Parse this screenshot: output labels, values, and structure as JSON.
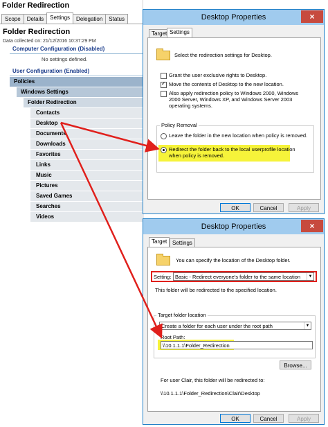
{
  "gpmc": {
    "title": "Folder Redirection",
    "tabs": [
      "Scope",
      "Details",
      "Settings",
      "Delegation",
      "Status"
    ],
    "active_tab": 2,
    "heading": "Folder Redirection",
    "data_collected": "Data collected on: 21/12/2016 10:37:29 PM",
    "computer_config": "Computer Configuration (Disabled)",
    "no_settings": "No settings defined.",
    "user_config": "User Configuration (Enabled)",
    "tree": {
      "policies": "Policies",
      "windows_settings": "Windows Settings",
      "folder_redirection": "Folder Redirection",
      "items": [
        "Contacts",
        "Desktop",
        "Documents",
        "Downloads",
        "Favorites",
        "Links",
        "Music",
        "Pictures",
        "Saved Games",
        "Searches",
        "Videos"
      ]
    }
  },
  "dialog_settings": {
    "title": "Desktop Properties",
    "close": "×",
    "tabs": [
      "Target",
      "Settings"
    ],
    "intro": "Select the redirection settings for Desktop.",
    "opt_exclusive": "Grant the user exclusive rights to Desktop.",
    "opt_move": "Move the contents of Desktop to the new location.",
    "opt_legacy": "Also apply redirection policy to Windows 2000, Windows 2000 Server, Windows XP, and Windows Server 2003 operating systems.",
    "policy_removal_label": "Policy Removal",
    "leave_option": "Leave the folder in the new location when policy is removed.",
    "redirect_back_option": "Redirect the folder back to the local userprofile location when policy is removed.",
    "ok": "OK",
    "cancel": "Cancel",
    "apply": "Apply"
  },
  "dialog_target": {
    "title": "Desktop Properties",
    "close": "×",
    "tabs": [
      "Target",
      "Settings"
    ],
    "intro": "You can specify the location of the Desktop folder.",
    "setting_label": "Setting:",
    "setting_value": "Basic - Redirect everyone's folder to the same location",
    "redirect_note": "This folder will be redirected to the specified location.",
    "target_group_label": "Target folder location",
    "target_value": "Create a folder for each user under the root path",
    "root_path_label": "Root Path:",
    "root_path_value": "\\\\10.1.1.1\\Folder_Redirection",
    "browse": "Browse...",
    "for_user": "For user Clair, this folder will be redirected to:",
    "redirect_path": "\\\\10.1.1.1\\Folder_Redirection\\Clair\\Desktop",
    "ok": "OK",
    "cancel": "Cancel",
    "apply": "Apply"
  },
  "colors": {
    "highlight": "#f6f33a",
    "annotation_red": "#e0201c",
    "titlebar": "#a0cbee",
    "close_button": "#c74a3e"
  }
}
